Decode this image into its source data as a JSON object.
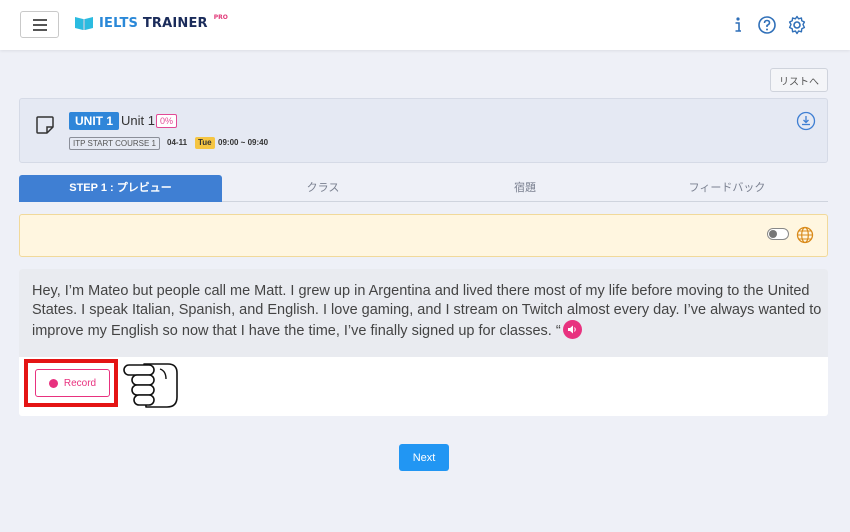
{
  "header": {
    "logo_main": "IELTS TRAINER",
    "logo_suffix": "PRO",
    "icons": [
      "menu-icon",
      "info-icon",
      "help-icon",
      "settings-icon"
    ]
  },
  "list_button": "リストへ",
  "unit": {
    "badge": "UNIT 1",
    "name": "Unit 1",
    "progress": "0%",
    "course": "ITP START COURSE 1",
    "date": "04-11",
    "day": "Tue",
    "time": "09:00 ~ 09:40"
  },
  "tabs": [
    {
      "label": "STEP 1 : プレビュー",
      "active": true
    },
    {
      "label": "クラス",
      "active": false
    },
    {
      "label": "宿題",
      "active": false
    },
    {
      "label": "フィードバック",
      "active": false
    }
  ],
  "passage": {
    "text": "Hey, I’m Mateo but people call me Matt. I grew up in Argentina and lived there most of my life before moving to the United States. I speak Italian, Spanish, and English. I love gaming, and I stream on Twitch almost every day. I’ve always wanted to improve my English so now that I have the time, I’ve finally signed up for classes. “"
  },
  "record_button": "Record",
  "next_button": "Next",
  "colors": {
    "accent_blue": "#2f86d9",
    "tab_active": "#3f7fd3",
    "pink": "#e8327f",
    "highlight_red": "#e41414",
    "notice_bg": "#fff6e0"
  }
}
